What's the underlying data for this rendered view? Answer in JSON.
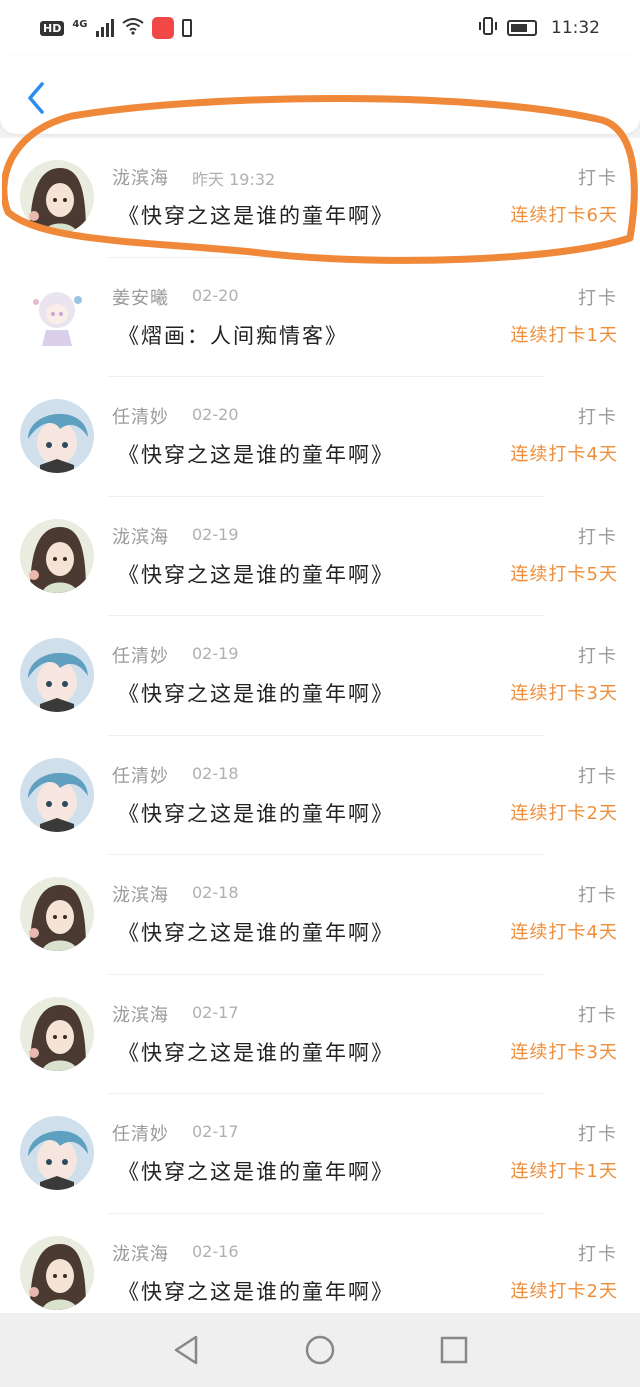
{
  "status_bar": {
    "hd_label": "HD",
    "network_label": "4G",
    "time": "11:32"
  },
  "header": {
    "back_icon": "chevron-left-icon",
    "accent_color": "#2b8cf0"
  },
  "checkins": [
    {
      "name": "泷滨海",
      "date": "昨天 19:32",
      "title": "《快穿之这是谁的童年啊》",
      "type": "打卡",
      "streak": "连续打卡6天",
      "avatar": "girl-dark-hair"
    },
    {
      "name": "姜安曦",
      "date": "02-20",
      "title": "《熠画：人间痴情客》",
      "type": "打卡",
      "streak": "连续打卡1天",
      "avatar": "chibi-white-hair"
    },
    {
      "name": "任清妙",
      "date": "02-20",
      "title": "《快穿之这是谁的童年啊》",
      "type": "打卡",
      "streak": "连续打卡4天",
      "avatar": "boy-blue-hair"
    },
    {
      "name": "泷滨海",
      "date": "02-19",
      "title": "《快穿之这是谁的童年啊》",
      "type": "打卡",
      "streak": "连续打卡5天",
      "avatar": "girl-dark-hair"
    },
    {
      "name": "任清妙",
      "date": "02-19",
      "title": "《快穿之这是谁的童年啊》",
      "type": "打卡",
      "streak": "连续打卡3天",
      "avatar": "boy-blue-hair"
    },
    {
      "name": "任清妙",
      "date": "02-18",
      "title": "《快穿之这是谁的童年啊》",
      "type": "打卡",
      "streak": "连续打卡2天",
      "avatar": "boy-blue-hair"
    },
    {
      "name": "泷滨海",
      "date": "02-18",
      "title": "《快穿之这是谁的童年啊》",
      "type": "打卡",
      "streak": "连续打卡4天",
      "avatar": "girl-dark-hair"
    },
    {
      "name": "泷滨海",
      "date": "02-17",
      "title": "《快穿之这是谁的童年啊》",
      "type": "打卡",
      "streak": "连续打卡3天",
      "avatar": "girl-dark-hair"
    },
    {
      "name": "任清妙",
      "date": "02-17",
      "title": "《快穿之这是谁的童年啊》",
      "type": "打卡",
      "streak": "连续打卡1天",
      "avatar": "boy-blue-hair"
    },
    {
      "name": "泷滨海",
      "date": "02-16",
      "title": "《快穿之这是谁的童年啊》",
      "type": "打卡",
      "streak": "连续打卡2天",
      "avatar": "girl-dark-hair"
    }
  ],
  "colors": {
    "streak": "#ef8e3a",
    "highlight_stroke": "#f0883a"
  },
  "nav": {
    "back_icon": "triangle-back-icon",
    "home_icon": "circle-home-icon",
    "recents_icon": "square-recents-icon"
  }
}
